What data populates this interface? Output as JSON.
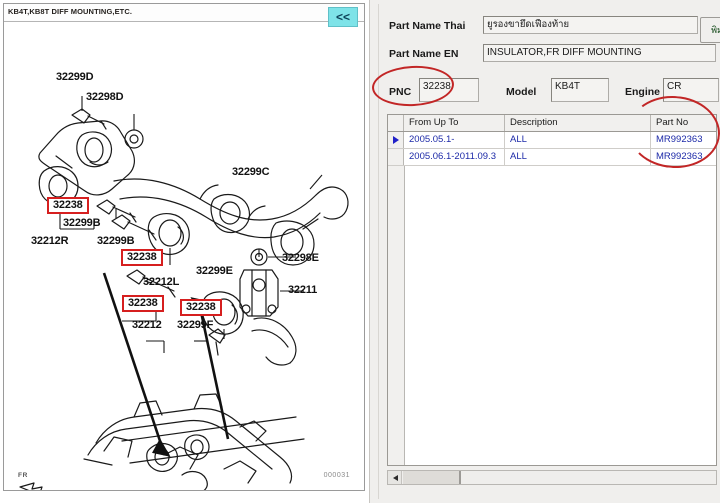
{
  "diagram": {
    "title": "KB4T,KB8T DIFF MOUNTING,ETC.",
    "back_button": "<<",
    "orientation_marker": "FR",
    "sheet_code": "000031",
    "labels": [
      {
        "text": "32299D",
        "boxed": false
      },
      {
        "text": "32298D",
        "boxed": false
      },
      {
        "text": "32299C",
        "boxed": false
      },
      {
        "text": "32238",
        "boxed": true
      },
      {
        "text": "32299B",
        "boxed": false
      },
      {
        "text": "32212R",
        "boxed": false
      },
      {
        "text": "32299B",
        "boxed": false
      },
      {
        "text": "32238",
        "boxed": true
      },
      {
        "text": "32238",
        "boxed": true
      },
      {
        "text": "32212L",
        "boxed": false
      },
      {
        "text": "32299E",
        "boxed": false
      },
      {
        "text": "32298E",
        "boxed": false
      },
      {
        "text": "32211",
        "boxed": false
      },
      {
        "text": "32238",
        "boxed": true
      },
      {
        "text": "32299F",
        "boxed": false
      },
      {
        "text": "32212",
        "boxed": false
      }
    ]
  },
  "form": {
    "part_name_thai_label": "Part Name Thai",
    "part_name_thai_value": "ยูรองขายึดเฟืองท้าย",
    "part_name_en_label": "Part Name EN",
    "part_name_en_value": "INSULATOR,FR DIFF MOUNTING",
    "pnc_label": "PNC",
    "pnc_value": "32238",
    "model_label": "Model",
    "model_value": "KB4T",
    "engine_label": "Engine",
    "engine_value": "CR",
    "print_button_label": "พิมพ์"
  },
  "grid": {
    "columns": [
      "From Up To",
      "Description",
      "Part No"
    ],
    "rows": [
      {
        "selected": true,
        "from_up_to": "2005.05.1-",
        "description": "ALL",
        "part_no": "MR992363"
      },
      {
        "selected": false,
        "from_up_to": "2005.06.1-2011.09.3",
        "description": "ALL",
        "part_no": "MR992363"
      }
    ]
  },
  "colors": {
    "annotation_red": "#c22626",
    "back_button_cyan": "#7ee3e8",
    "grid_text_blue": "#1d2aa8"
  }
}
